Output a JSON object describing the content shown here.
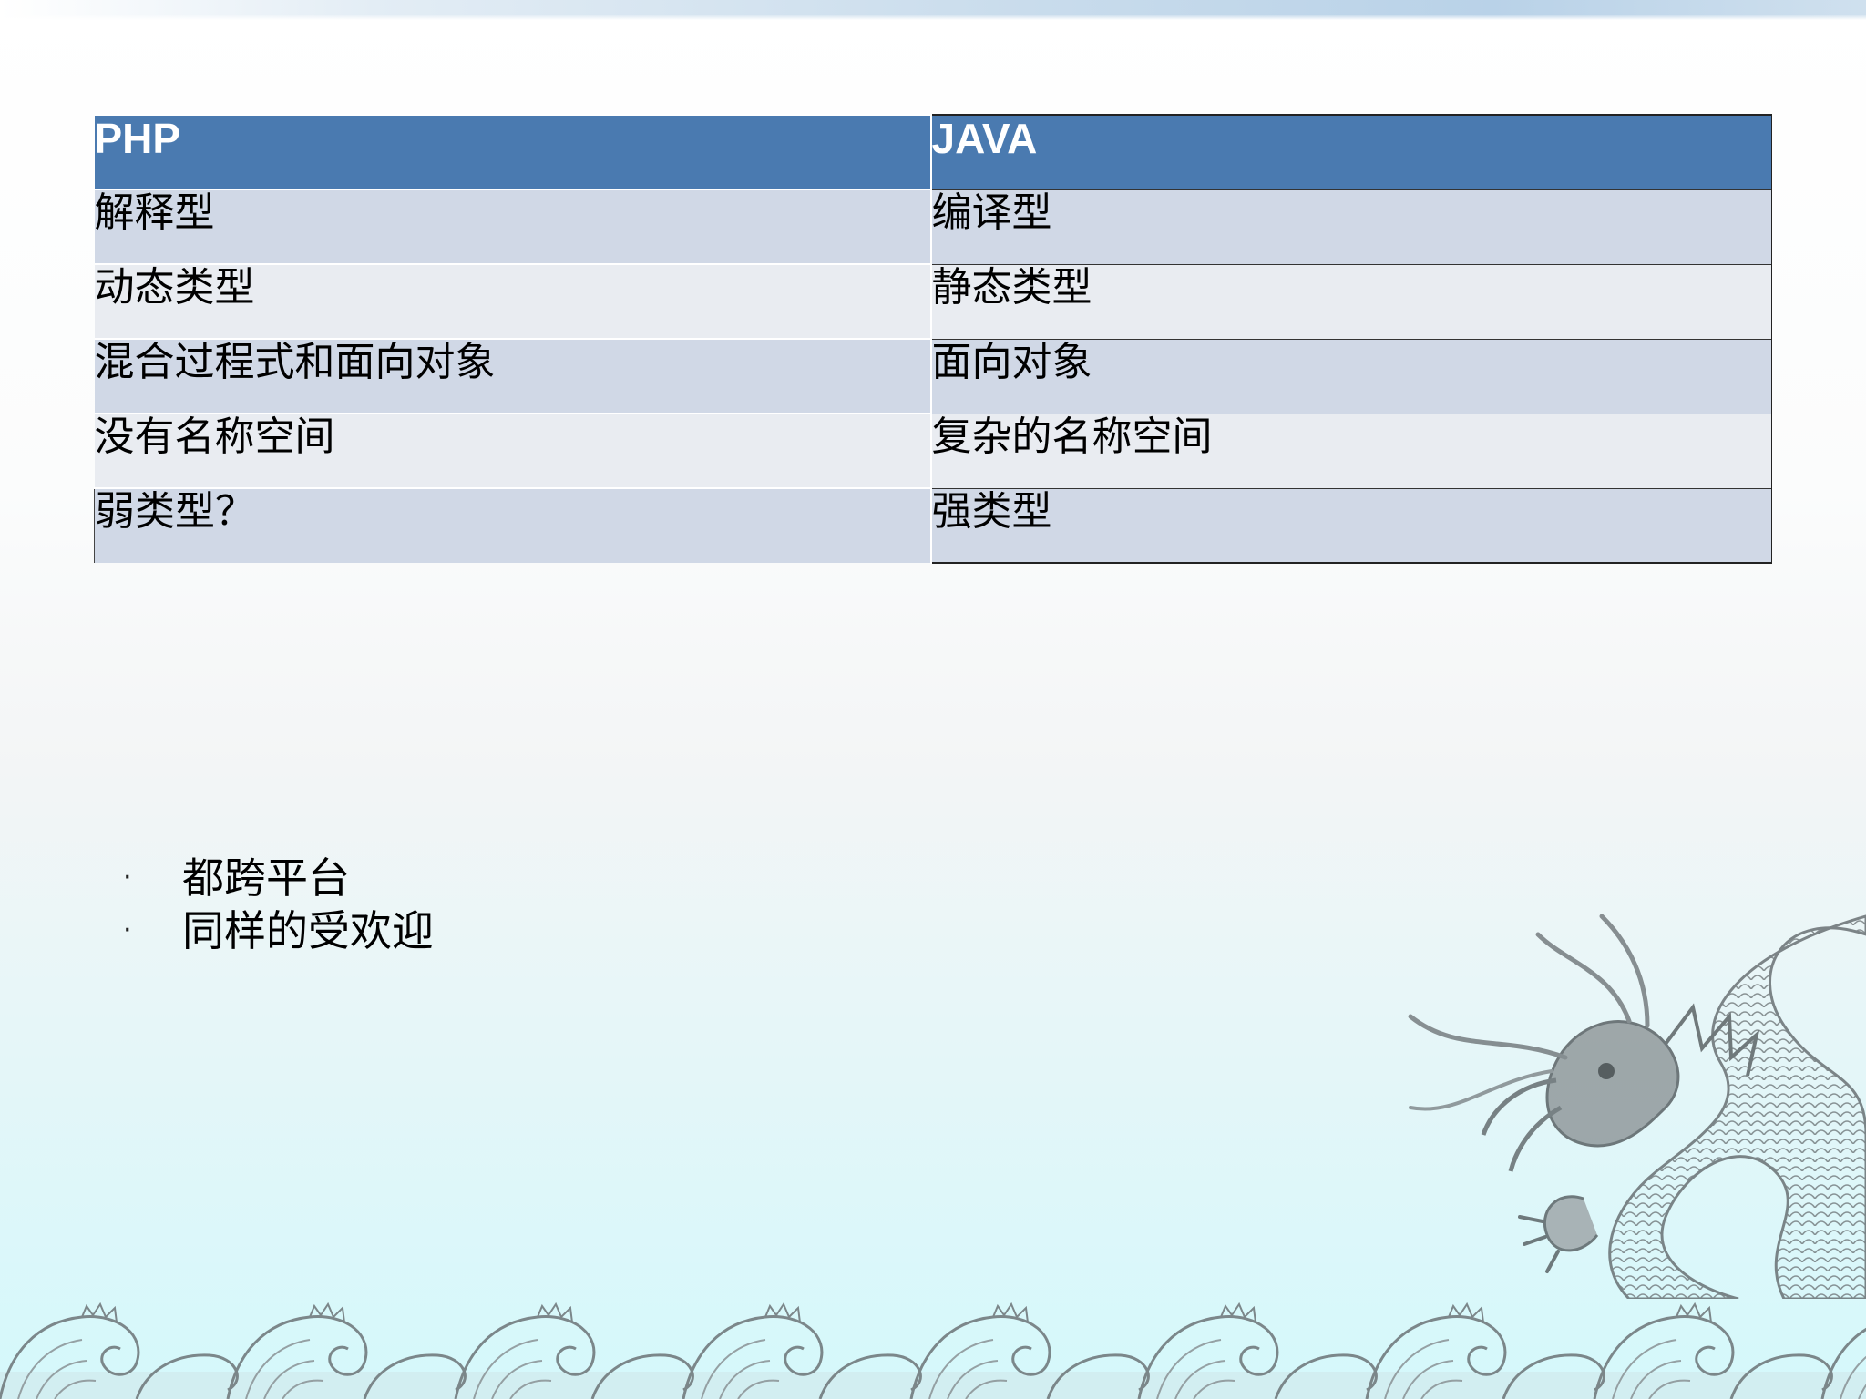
{
  "table": {
    "header": [
      "PHP",
      "JAVA"
    ],
    "rows": [
      [
        "解释型",
        "编译型"
      ],
      [
        "动态类型",
        "静态类型"
      ],
      [
        "混合过程式和面向对象",
        "面向对象"
      ],
      [
        "没有名称空间",
        "复杂的名称空间"
      ],
      [
        "弱类型？",
        "强类型"
      ]
    ]
  },
  "bullets": {
    "marker": "·",
    "items": [
      "都跨平台",
      "同样的受欢迎"
    ]
  },
  "colors": {
    "header_bg": "#4a7ab0",
    "row_odd": "#d0d8e6",
    "row_even": "#e9ecf1"
  },
  "decorations": [
    "dragon-illustration",
    "ocean-wave-border"
  ]
}
